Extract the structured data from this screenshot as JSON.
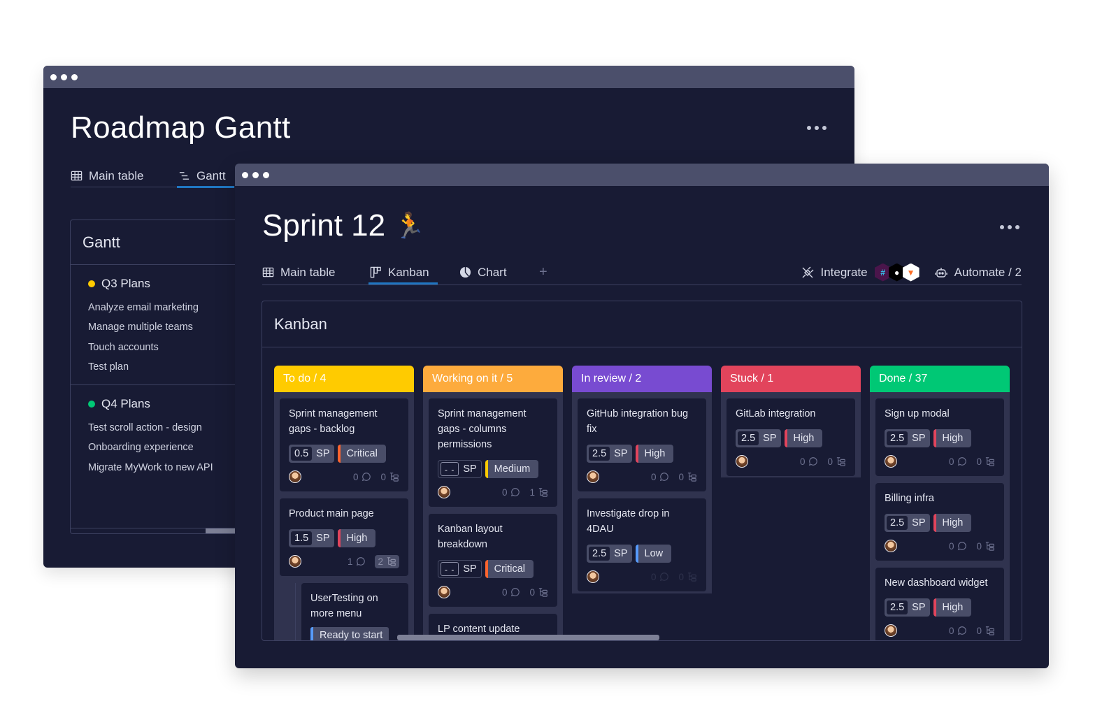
{
  "back_window": {
    "title": "Roadmap Gantt",
    "tabs": [
      {
        "label": "Main table",
        "icon": "table-icon",
        "active": false
      },
      {
        "label": "Gantt",
        "icon": "gantt-icon",
        "active": true
      }
    ],
    "panel": {
      "title": "Gantt",
      "groups": [
        {
          "title": "Q3 Plans",
          "color": "#ffcb00",
          "items": [
            "Analyze email marketing",
            "Manage multiple teams",
            "Touch accounts",
            "Test plan"
          ]
        },
        {
          "title": "Q4 Plans",
          "color": "#00c875",
          "items": [
            "Test scroll action - design",
            "Onboarding experience",
            "Migrate MyWork to new API"
          ]
        }
      ]
    }
  },
  "front_window": {
    "title": "Sprint 12",
    "title_emoji": "🏃",
    "tabs": [
      {
        "label": "Main table",
        "icon": "table-icon",
        "active": false
      },
      {
        "label": "Kanban",
        "icon": "kanban-icon",
        "active": true
      },
      {
        "label": "Chart",
        "icon": "chart-icon",
        "active": false
      }
    ],
    "add_tab_label": "+",
    "integrate_label": "Integrate",
    "integrations": [
      "slack",
      "github",
      "gitlab"
    ],
    "automate_label": "Automate / 2",
    "panel_title": "Kanban",
    "columns": [
      {
        "label": "To do / 4",
        "color": "#ffcb00",
        "cards": [
          {
            "title": "Sprint management gaps - backlog",
            "sp": "0.5",
            "sp_unit": "SP",
            "priority": "Critical",
            "priority_color": "#ff642e",
            "comments": "0",
            "subitems": "0"
          },
          {
            "title": "Product main page",
            "sp": "1.5",
            "sp_unit": "SP",
            "priority": "High",
            "priority_color": "#e2445c",
            "comments": "1",
            "subitems": "2",
            "subitems_highlight": true,
            "subitem": {
              "title": "UserTesting on more menu",
              "status": "Ready to start"
            }
          }
        ]
      },
      {
        "label": "Working on it / 5",
        "color": "#fdab3d",
        "cards": [
          {
            "title": "Sprint management gaps - columns permissions",
            "sp": "- -",
            "sp_unit": "SP",
            "priority": "Medium",
            "priority_color": "#ffcb00",
            "comments": "0",
            "subitems": "1"
          },
          {
            "title": "Kanban layout breakdown",
            "sp": "- -",
            "sp_unit": "SP",
            "priority": "Critical",
            "priority_color": "#ff642e",
            "comments": "0",
            "subitems": "0"
          },
          {
            "title": "LP content update"
          }
        ]
      },
      {
        "label": "In review / 2",
        "color": "#784bd1",
        "cards": [
          {
            "title": "GitHub integration bug fix",
            "sp": "2.5",
            "sp_unit": "SP",
            "priority": "High",
            "priority_color": "#e2445c",
            "comments": "0",
            "subitems": "0"
          },
          {
            "title": "Investigate drop in 4DAU",
            "sp": "2.5",
            "sp_unit": "SP",
            "priority": "Low",
            "priority_color": "#579bfc",
            "comments": "0",
            "subitems": "0",
            "faded": true
          }
        ]
      },
      {
        "label": "Stuck / 1",
        "color": "#e2445c",
        "cards": [
          {
            "title": "GitLab integration",
            "sp": "2.5",
            "sp_unit": "SP",
            "priority": "High",
            "priority_color": "#e2445c",
            "comments": "0",
            "subitems": "0"
          }
        ]
      },
      {
        "label": "Done  / 37",
        "color": "#00c875",
        "cards": [
          {
            "title": "Sign up modal",
            "sp": "2.5",
            "sp_unit": "SP",
            "priority": "High",
            "priority_color": "#e2445c",
            "comments": "0",
            "subitems": "0"
          },
          {
            "title": "Billing infra",
            "sp": "2.5",
            "sp_unit": "SP",
            "priority": "High",
            "priority_color": "#e2445c",
            "comments": "0",
            "subitems": "0"
          },
          {
            "title": "New dashboard widget",
            "sp": "2.5",
            "sp_unit": "SP",
            "priority": "High",
            "priority_color": "#e2445c",
            "comments": "0",
            "subitems": "0"
          }
        ]
      }
    ]
  }
}
